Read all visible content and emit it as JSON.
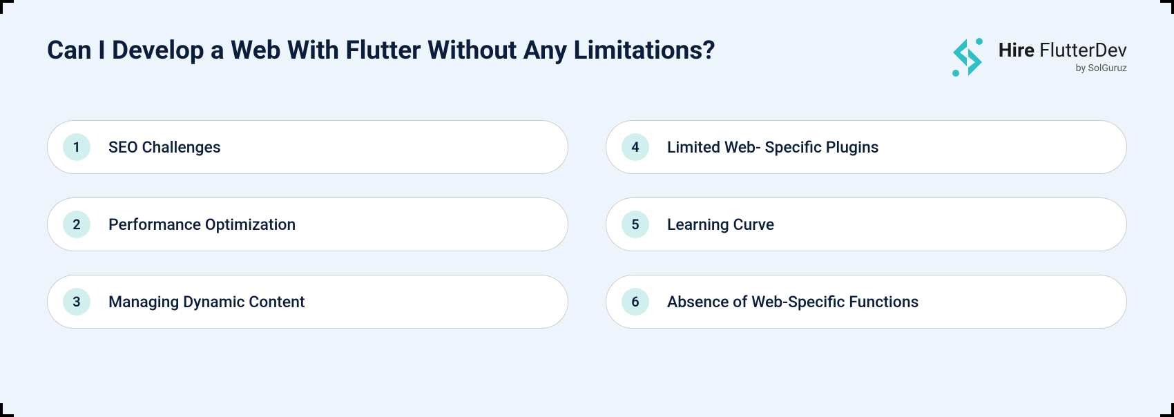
{
  "title": "Can I Develop a Web With Flutter Without Any Limitations?",
  "logo": {
    "brand_bold": "Hire",
    "brand_light": "FlutterDev",
    "byline": "by SolGuruz"
  },
  "items": [
    {
      "num": "1",
      "label": "SEO Challenges"
    },
    {
      "num": "2",
      "label": "Performance Optimization"
    },
    {
      "num": "3",
      "label": "Managing Dynamic Content"
    },
    {
      "num": "4",
      "label": "Limited Web- Specific Plugins"
    },
    {
      "num": "5",
      "label": "Learning Curve"
    },
    {
      "num": "6",
      "label": "Absence of Web-Specific Functions"
    }
  ],
  "colors": {
    "accent": "#2ec0c4",
    "bg": "#eef4fb",
    "text": "#0a1e3c",
    "chip": "#d2eff0"
  }
}
